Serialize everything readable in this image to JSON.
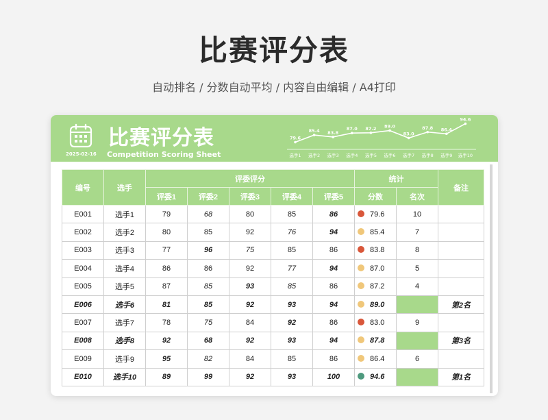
{
  "page": {
    "title": "比赛评分表",
    "subtitle": "自动排名 / 分数自动平均 / 内容自由编辑 / A4打印"
  },
  "banner": {
    "title": "比赛评分表",
    "subtitle_en": "Competition Scoring Sheet",
    "date": "2025-02-16",
    "bg_color": "#a8d98b"
  },
  "chart_data": {
    "type": "line",
    "categories": [
      "选手1",
      "选手2",
      "选手3",
      "选手4",
      "选手5",
      "选手6",
      "选手7",
      "选手8",
      "选手9",
      "选手10"
    ],
    "values": [
      79.6,
      85.4,
      83.8,
      87.0,
      87.2,
      89.0,
      83.0,
      87.8,
      86.4,
      94.6
    ],
    "labels": [
      "79.6",
      "85.4",
      "83.8",
      "87.0",
      "87.2",
      "89.0",
      "83.0",
      "87.8",
      "86.4",
      "94.6"
    ],
    "ylim": [
      60,
      100
    ],
    "grid": false
  },
  "table": {
    "headers": {
      "id": "编号",
      "player": "选手",
      "judges_group": "评委评分",
      "judges": [
        "评委1",
        "评委2",
        "评委3",
        "评委4",
        "评委5"
      ],
      "stats_group": "统计",
      "score": "分数",
      "rank": "名次",
      "note": "备注"
    },
    "rows": [
      {
        "id": "E001",
        "player": "选手1",
        "scores": [
          "79",
          "68",
          "80",
          "85",
          "86"
        ],
        "avg": "79.6",
        "rank": "10",
        "note": "",
        "highlight": false,
        "dot": "red",
        "max_idx": 4,
        "min_idx": 1
      },
      {
        "id": "E002",
        "player": "选手2",
        "scores": [
          "80",
          "85",
          "92",
          "76",
          "94"
        ],
        "avg": "85.4",
        "rank": "7",
        "note": "",
        "highlight": false,
        "dot": "yellow",
        "max_idx": 4,
        "min_idx": 3
      },
      {
        "id": "E003",
        "player": "选手3",
        "scores": [
          "77",
          "96",
          "75",
          "85",
          "86"
        ],
        "avg": "83.8",
        "rank": "8",
        "note": "",
        "highlight": false,
        "dot": "red",
        "max_idx": 1,
        "min_idx": 2
      },
      {
        "id": "E004",
        "player": "选手4",
        "scores": [
          "86",
          "86",
          "92",
          "77",
          "94"
        ],
        "avg": "87.0",
        "rank": "5",
        "note": "",
        "highlight": false,
        "dot": "yellow",
        "max_idx": 4,
        "min_idx": 3
      },
      {
        "id": "E005",
        "player": "选手5",
        "scores": [
          "87",
          "85",
          "93",
          "85",
          "86"
        ],
        "avg": "87.2",
        "rank": "4",
        "note": "",
        "highlight": false,
        "dot": "yellow",
        "max_idx": 2,
        "min_idx": 1,
        "min_idx2": 3
      },
      {
        "id": "E006",
        "player": "选手6",
        "scores": [
          "81",
          "85",
          "92",
          "93",
          "94"
        ],
        "avg": "89.0",
        "rank": "",
        "note": "第2名",
        "highlight": true,
        "dot": "yellow",
        "max_idx": -1,
        "min_idx": -1
      },
      {
        "id": "E007",
        "player": "选手7",
        "scores": [
          "78",
          "75",
          "84",
          "92",
          "86"
        ],
        "avg": "83.0",
        "rank": "9",
        "note": "",
        "highlight": false,
        "dot": "red",
        "max_idx": 3,
        "min_idx": 1
      },
      {
        "id": "E008",
        "player": "选手8",
        "scores": [
          "92",
          "68",
          "92",
          "93",
          "94"
        ],
        "avg": "87.8",
        "rank": "",
        "note": "第3名",
        "highlight": true,
        "dot": "yellow",
        "max_idx": -1,
        "min_idx": -1
      },
      {
        "id": "E009",
        "player": "选手9",
        "scores": [
          "95",
          "82",
          "84",
          "85",
          "86"
        ],
        "avg": "86.4",
        "rank": "6",
        "note": "",
        "highlight": false,
        "dot": "yellow",
        "max_idx": 0,
        "min_idx": 1
      },
      {
        "id": "E010",
        "player": "选手10",
        "scores": [
          "89",
          "99",
          "92",
          "93",
          "100"
        ],
        "avg": "94.6",
        "rank": "",
        "note": "第1名",
        "highlight": true,
        "dot": "green",
        "max_idx": -1,
        "min_idx": -1
      }
    ],
    "dot_colors": {
      "red": "#d9573a",
      "yellow": "#f0c77a",
      "green": "#4e9a7e"
    },
    "highlight_color": "#a8d98b"
  }
}
